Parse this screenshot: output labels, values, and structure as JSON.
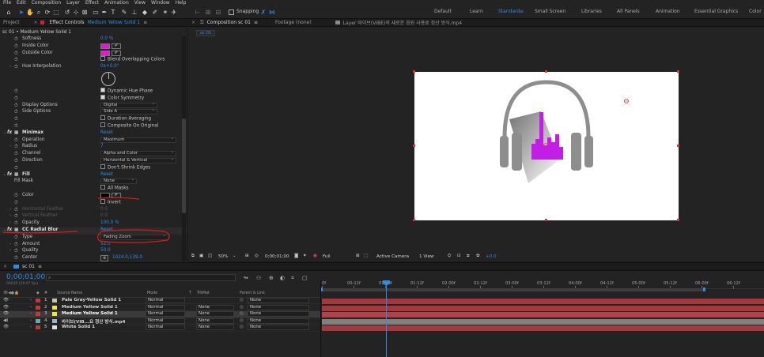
{
  "menu": [
    "File",
    "Edit",
    "Composition",
    "Layer",
    "Effect",
    "Animation",
    "View",
    "Window",
    "Help"
  ],
  "toolbar": {
    "snapping_label": "Snapping",
    "workspaces": [
      "Default",
      "Learn",
      "Standard",
      "Small Screen",
      "Libraries",
      "All Panels",
      "Animation",
      "Essential Graphics",
      "Color"
    ],
    "active_workspace": "Standard",
    "menu_glyph": "≡"
  },
  "left_panel": {
    "tabs": [
      "Project",
      "Effect Controls",
      "Medium Yellow Solid 1",
      "≡"
    ],
    "title": "sc 01 • Medium Yellow Solid 1",
    "rows": [
      {
        "label": "Softness",
        "value": "0.0 %",
        "indent": 14,
        "dim": false,
        "kind": "val"
      },
      {
        "label": "Inside Color",
        "indent": 10,
        "kind": "color",
        "color": "#e815d8"
      },
      {
        "label": "Outside Color",
        "indent": 10,
        "kind": "color",
        "color": "#e815d8"
      },
      {
        "label": "",
        "indent": 10,
        "kind": "check",
        "text": "Blend Overlapping Colors",
        "checked": false
      },
      {
        "label": "Hue Interpolation",
        "indent": 10,
        "kind": "val",
        "value": "0x+0.0°"
      }
    ],
    "rows2": [
      {
        "label": "",
        "kind": "check",
        "text": "Dynamic Hue Phase",
        "checked": true
      },
      {
        "label": "",
        "kind": "check",
        "text": "Color Symmetry",
        "checked": true
      },
      {
        "label": "Display Options",
        "kind": "dd",
        "text": "Digital"
      },
      {
        "label": "Side Options",
        "kind": "dd",
        "text": "Side A"
      },
      {
        "label": "",
        "kind": "check",
        "text": "Duration Averaging",
        "checked": false
      },
      {
        "label": "",
        "kind": "check",
        "text": "Composite On Original",
        "checked": false
      }
    ],
    "minimax": {
      "name": "Minimax",
      "reset": "Reset",
      "operation_label": "Operation",
      "operation": "Maximum",
      "radius_label": "Radius",
      "radius": "7",
      "channel_label": "Channel",
      "channel": "Alpha and Color",
      "direction_label": "Direction",
      "direction": "Horizontal & Vertical",
      "dont_shrink": "Don't Shrink Edges"
    },
    "fill": {
      "name": "Fill",
      "reset": "Reset",
      "mask_label": "Fill Mask",
      "mask": "None",
      "all_masks": "All Masks",
      "color_label": "Color",
      "color": "#000000",
      "invert": "Invert",
      "hfeather_label": "Horizontal Feather",
      "hfeather": "0.0",
      "vfeather_label": "Vertical Feather",
      "vfeather": "0.0",
      "opacity_label": "Opacity",
      "opacity": "100.0 %"
    },
    "ccradial": {
      "name": "CC Radial Blur",
      "reset": "Reset",
      "type_label": "Type",
      "type": "Fading Zoom",
      "amount_label": "Amount",
      "amount": "52.0",
      "quality_label": "Quality",
      "quality": "50.0",
      "center_label": "Center",
      "center": "1024.0,139.0"
    }
  },
  "comp_panel": {
    "tabs": [
      "Composition sc 01",
      "Footage (none)",
      "Layer 바이브(VIBE)의 새로운 음원 사용료 정산 방식.mp4"
    ],
    "sub_tab": "sc 01",
    "bottom": {
      "zoom": "50%",
      "timecode": "0;00;01;00",
      "resolution": "Full",
      "camera": "Active Camera",
      "view": "1 View",
      "exposure": "+0.0"
    }
  },
  "timeline": {
    "tab": "sc 01",
    "timecode": "0;00;01;00",
    "frames_label": "00030 (29.97 fps)",
    "search_placeholder": "",
    "columns": {
      "source": "Source Name",
      "mode": "Mode",
      "t": "T",
      "trkmat": "TrkMat",
      "parent": "Parent & Link"
    },
    "ruler": [
      "0f",
      "00:12f",
      "01:00f",
      "01:12f",
      "02:00f",
      "02:12f",
      "03:00f",
      "03:12f",
      "04:00f",
      "04:12f",
      "05:00f",
      "05:12f",
      "06:00f",
      "06:12f"
    ],
    "layers": [
      {
        "num": "1",
        "name": "Pale Gray-Yellow Solid 1",
        "color": "#c9c9a0",
        "mode": "Normal",
        "trkmat": "",
        "parent": "None"
      },
      {
        "num": "2",
        "name": "Medium Yellow Solid 1",
        "color": "#f2e636",
        "mode": "Normal",
        "trkmat": "None",
        "parent": "None"
      },
      {
        "num": "3",
        "name": "Medium Yellow Solid 1",
        "color": "#f2e636",
        "mode": "Normal",
        "trkmat": "None",
        "parent": "None"
      },
      {
        "num": "4",
        "name": "바이브(VIB...요 정산 방식.mp4",
        "color": "#8fb7c8",
        "mode": "Normal",
        "trkmat": "None",
        "parent": "None"
      },
      {
        "num": "5",
        "name": "White Solid 1",
        "color": "#e0e0e0",
        "mode": "Normal",
        "trkmat": "None",
        "parent": "None"
      }
    ]
  },
  "colors": {
    "accent": "#2d8ceb",
    "track_red": "#a3393d",
    "track_gray": "#7f7f7f",
    "annotation": "#e0181c"
  }
}
